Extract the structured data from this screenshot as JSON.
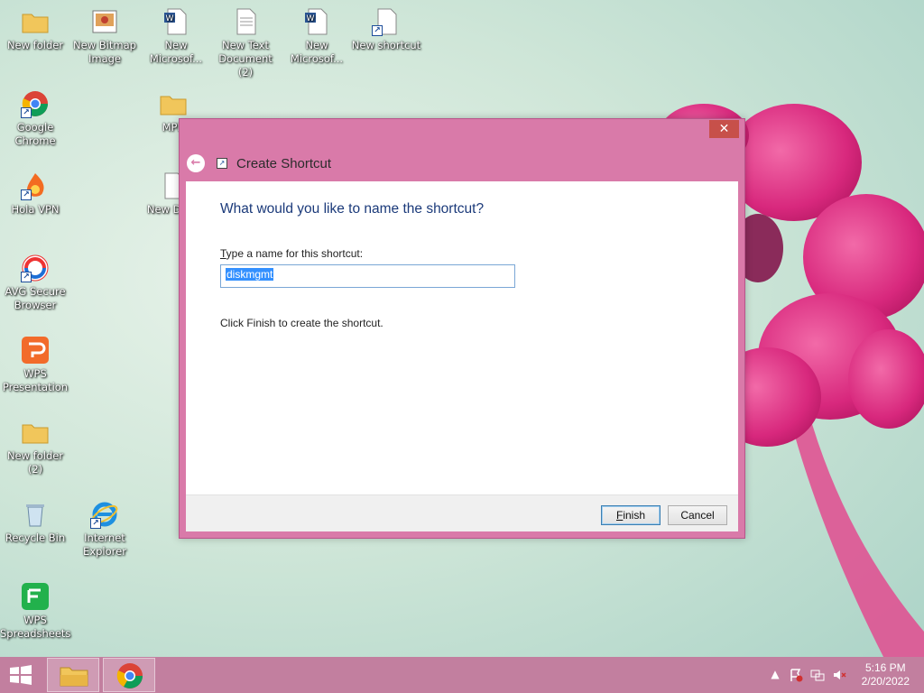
{
  "desktop": {
    "icons": [
      {
        "id": "new-folder",
        "label": "New folder"
      },
      {
        "id": "new-bitmap",
        "label": "New Bitmap Image"
      },
      {
        "id": "new-ms-word-1",
        "label": "New Microsof..."
      },
      {
        "id": "new-text-doc-2",
        "label": "New Text Document (2)"
      },
      {
        "id": "new-ms-word-2",
        "label": "New Microsof..."
      },
      {
        "id": "new-shortcut",
        "label": "New shortcut"
      },
      {
        "id": "google-chrome",
        "label": "Google Chrome"
      },
      {
        "id": "mpr",
        "label": "MPR"
      },
      {
        "id": "hola-vpn",
        "label": "Hola VPN"
      },
      {
        "id": "new-doc-partial",
        "label": "New Docu"
      },
      {
        "id": "avg-browser",
        "label": "AVG Secure Browser"
      },
      {
        "id": "wps-presentation",
        "label": "WPS Presentation"
      },
      {
        "id": "new-folder-2",
        "label": "New folder (2)"
      },
      {
        "id": "recycle-bin",
        "label": "Recycle Bin"
      },
      {
        "id": "internet-explorer",
        "label": "Internet Explorer"
      },
      {
        "id": "wps-spreadsheets",
        "label": "WPS Spreadsheets"
      }
    ]
  },
  "dialog": {
    "title": "Create Shortcut",
    "close_glyph": "✕",
    "back_glyph": "←",
    "question": "What would you like to name the shortcut?",
    "label_accel": "T",
    "label_rest": "ype a name for this shortcut:",
    "input_value": "diskmgmt",
    "hint": "Click Finish to create the shortcut.",
    "finish_accel": "F",
    "finish_rest": "inish",
    "cancel_label": "Cancel"
  },
  "taskbar": {
    "time": "5:16 PM",
    "date": "2/20/2022",
    "tray_chevron": "▲"
  },
  "colors": {
    "dialog_frame": "#d97aa9",
    "taskbar": "#c27f9f",
    "heading_text": "#1b3a7a",
    "selection": "#3390ff"
  }
}
